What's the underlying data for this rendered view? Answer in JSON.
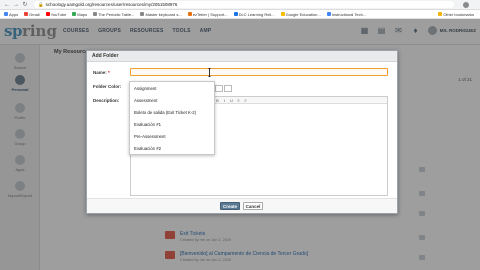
{
  "browser": {
    "url": "schoology.uamgold.org/resources/user/resources/my/2051508976",
    "bookmarks": [
      "Apps",
      "Gmail",
      "YouTube",
      "Maps",
      "The Periodic Table...",
      "Master keyboard s...",
      "ezTeber | Support...",
      "DLC Learning Reli...",
      "Google Education...",
      "Instructional Tech..."
    ],
    "other_bookmarks": "Other bookmarks"
  },
  "app": {
    "logo_part1": "sp",
    "logo_part2": "ring",
    "nav": [
      "COURSES",
      "GROUPS",
      "RESOURCES",
      "TOOLS",
      "AMP"
    ],
    "user_name": "MS. RODRIGUEZ"
  },
  "sidebar": {
    "items": [
      {
        "label": "Search",
        "icon": "search-icon"
      },
      {
        "label": "Personal",
        "icon": "personal-icon"
      },
      {
        "label": "Public",
        "icon": "public-icon"
      },
      {
        "label": "Group",
        "icon": "group-icon"
      },
      {
        "label": "Apps",
        "icon": "apps-icon"
      },
      {
        "label": "Import/Export",
        "icon": "import-export-icon"
      }
    ]
  },
  "background": {
    "heading": "My Resources",
    "of_label": "1 of 21",
    "rows": [
      {
        "title": "Exit Tickets",
        "sub": "Created by me on Jun 2, 2020"
      },
      {
        "title": "[Bienvenido] al Campamento de Ciencia de Tercer Grado]",
        "sub": "Created by me on Jun 2, 2020"
      }
    ]
  },
  "modal": {
    "title": "Add Folder",
    "name_label": "Name:",
    "required_mark": "*",
    "color_label": "Folder Color:",
    "description_label": "Description:",
    "dropdown_items": [
      "Assignment",
      "Assessment",
      "Boleto de salida (Exit Ticket K-2)",
      "Evaluación #1",
      "Pre-Assessment",
      "Evaluación #2"
    ],
    "create_label": "Create",
    "cancel_label": "Cancel"
  }
}
